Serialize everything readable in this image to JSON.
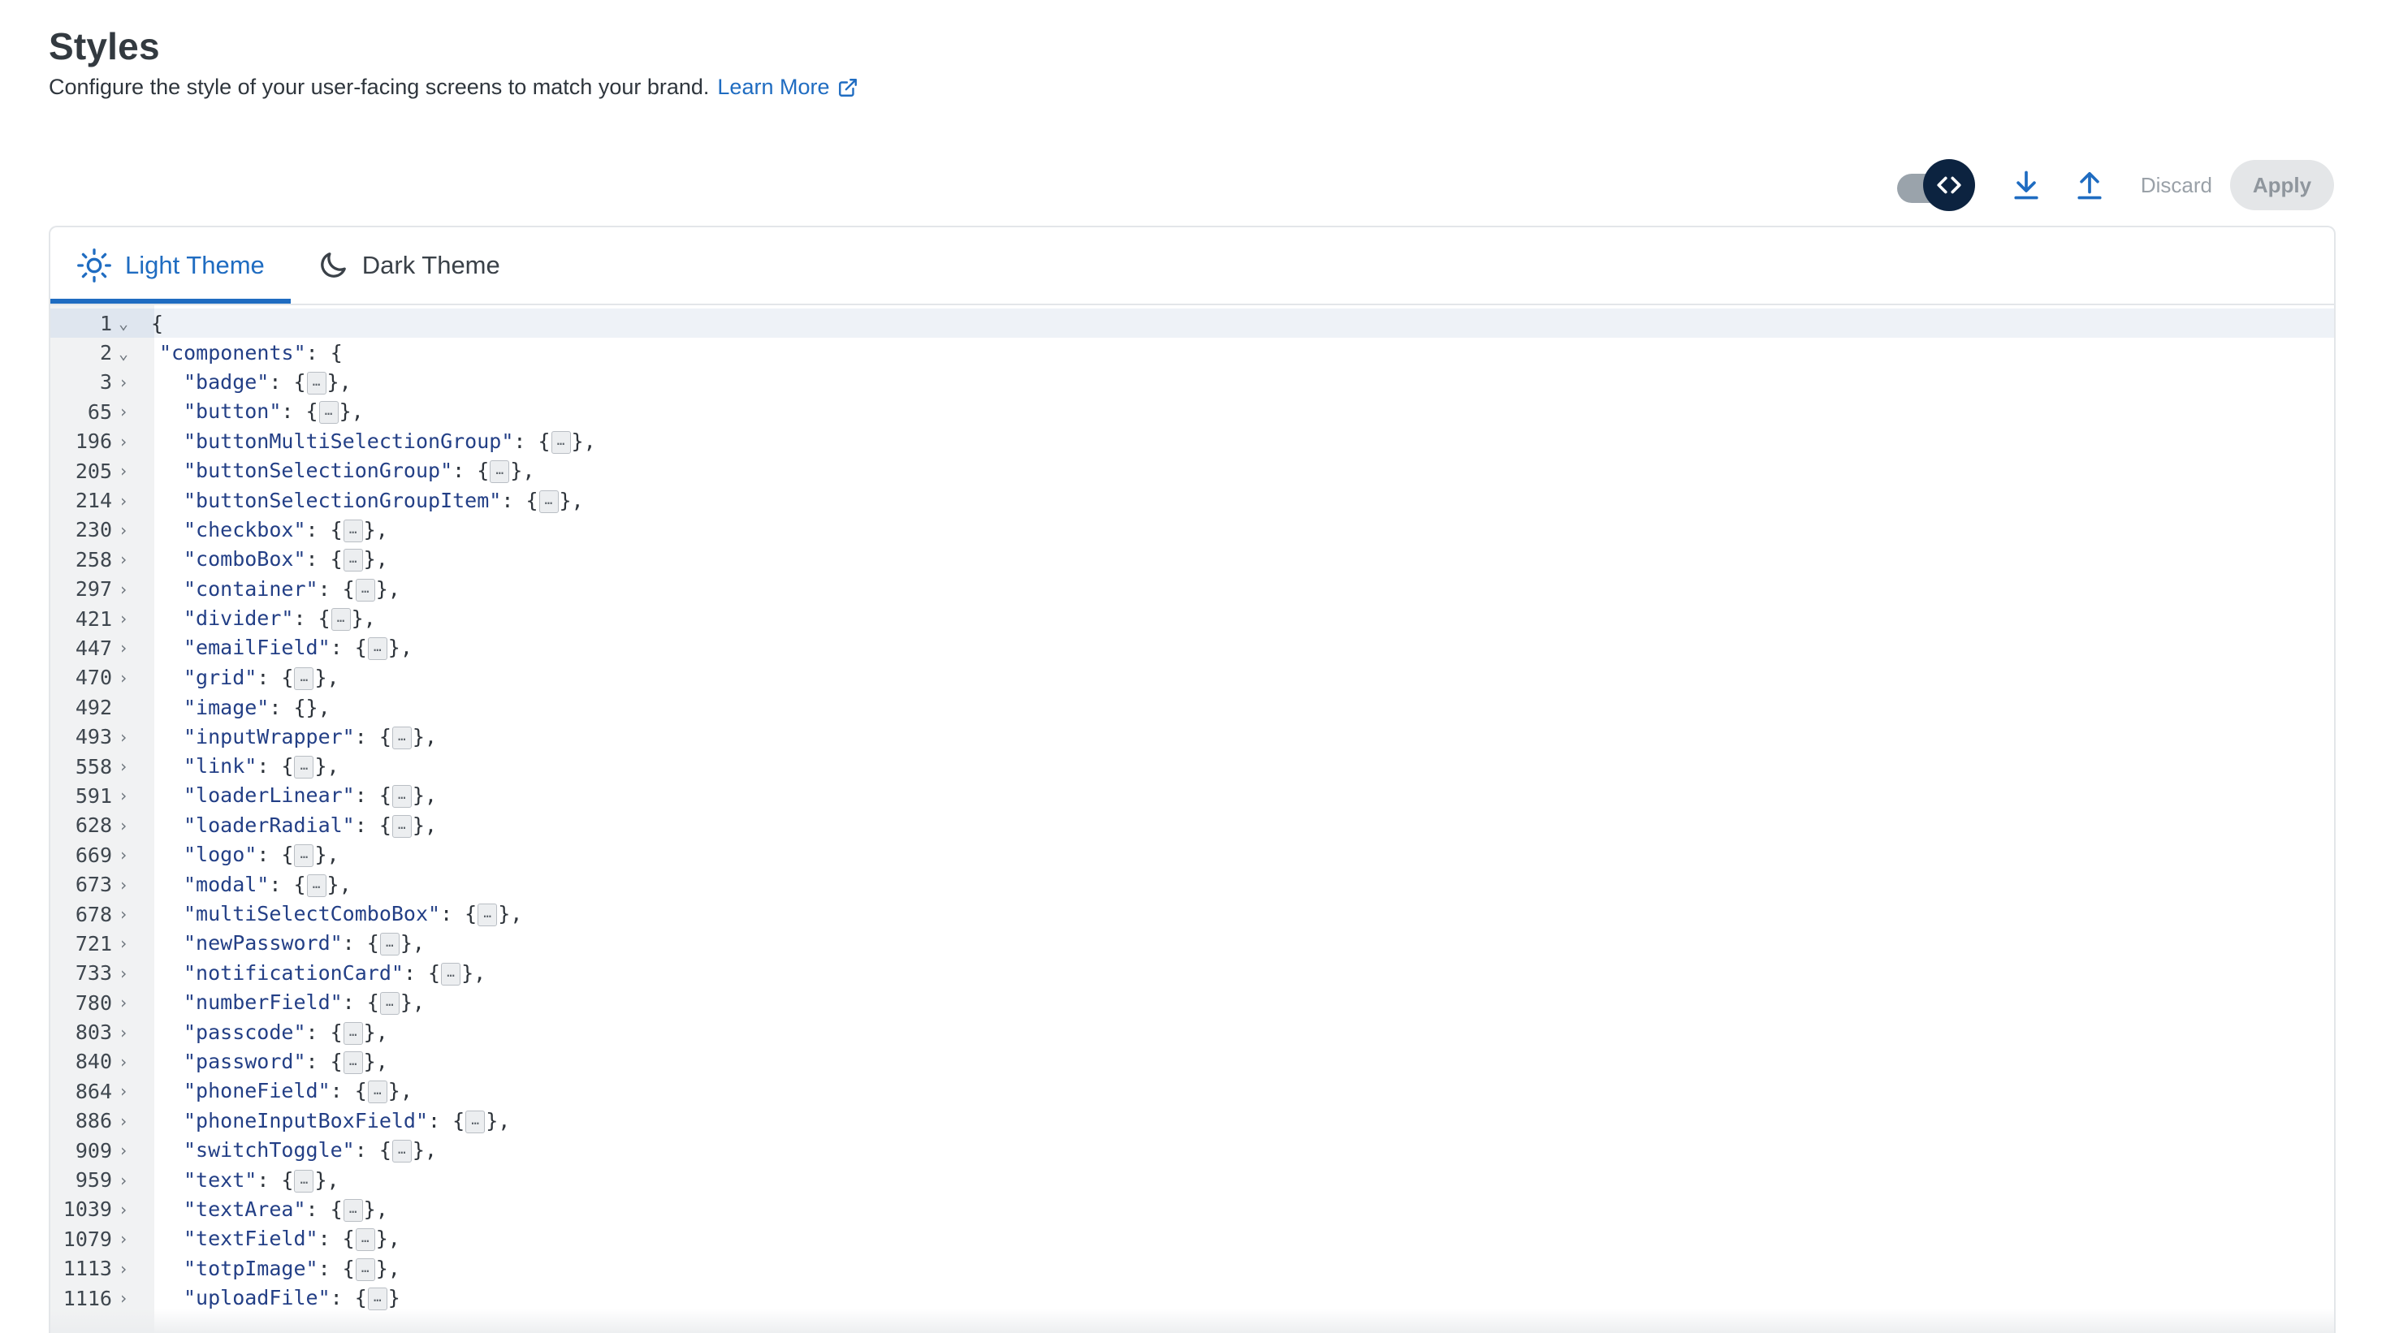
{
  "header": {
    "title": "Styles",
    "subtitle": "Configure the style of your user-facing screens to match your brand.",
    "learn_more": "Learn More"
  },
  "toolbar": {
    "toggle_icon": "code-icon",
    "download_icon": "download-icon",
    "upload_icon": "upload-icon",
    "discard_label": "Discard",
    "apply_label": "Apply"
  },
  "tabs": [
    {
      "label": "Light Theme",
      "icon": "sun-icon",
      "active": true
    },
    {
      "label": "Dark Theme",
      "icon": "moon-icon",
      "active": false
    }
  ],
  "editor": {
    "lines": [
      {
        "num": "1",
        "fold": "open",
        "indent": 0,
        "text": "{"
      },
      {
        "num": "2",
        "fold": "open",
        "indent": 1,
        "key": "components",
        "tail": ": {"
      },
      {
        "num": "3",
        "fold": "closed",
        "indent": 2,
        "key": "badge",
        "collapsed": true,
        "comma": true
      },
      {
        "num": "65",
        "fold": "closed",
        "indent": 2,
        "key": "button",
        "collapsed": true,
        "comma": true
      },
      {
        "num": "196",
        "fold": "closed",
        "indent": 2,
        "key": "buttonMultiSelectionGroup",
        "collapsed": true,
        "comma": true
      },
      {
        "num": "205",
        "fold": "closed",
        "indent": 2,
        "key": "buttonSelectionGroup",
        "collapsed": true,
        "comma": true
      },
      {
        "num": "214",
        "fold": "closed",
        "indent": 2,
        "key": "buttonSelectionGroupItem",
        "collapsed": true,
        "comma": true
      },
      {
        "num": "230",
        "fold": "closed",
        "indent": 2,
        "key": "checkbox",
        "collapsed": true,
        "comma": true
      },
      {
        "num": "258",
        "fold": "closed",
        "indent": 2,
        "key": "comboBox",
        "collapsed": true,
        "comma": true
      },
      {
        "num": "297",
        "fold": "closed",
        "indent": 2,
        "key": "container",
        "collapsed": true,
        "comma": true
      },
      {
        "num": "421",
        "fold": "closed",
        "indent": 2,
        "key": "divider",
        "collapsed": true,
        "comma": true
      },
      {
        "num": "447",
        "fold": "closed",
        "indent": 2,
        "key": "emailField",
        "collapsed": true,
        "comma": true
      },
      {
        "num": "470",
        "fold": "closed",
        "indent": 2,
        "key": "grid",
        "collapsed": true,
        "comma": true
      },
      {
        "num": "492",
        "fold": "none",
        "indent": 2,
        "key": "image",
        "tail": ": {},"
      },
      {
        "num": "493",
        "fold": "closed",
        "indent": 2,
        "key": "inputWrapper",
        "collapsed": true,
        "comma": true
      },
      {
        "num": "558",
        "fold": "closed",
        "indent": 2,
        "key": "link",
        "collapsed": true,
        "comma": true
      },
      {
        "num": "591",
        "fold": "closed",
        "indent": 2,
        "key": "loaderLinear",
        "collapsed": true,
        "comma": true
      },
      {
        "num": "628",
        "fold": "closed",
        "indent": 2,
        "key": "loaderRadial",
        "collapsed": true,
        "comma": true
      },
      {
        "num": "669",
        "fold": "closed",
        "indent": 2,
        "key": "logo",
        "collapsed": true,
        "comma": true
      },
      {
        "num": "673",
        "fold": "closed",
        "indent": 2,
        "key": "modal",
        "collapsed": true,
        "comma": true
      },
      {
        "num": "678",
        "fold": "closed",
        "indent": 2,
        "key": "multiSelectComboBox",
        "collapsed": true,
        "comma": true
      },
      {
        "num": "721",
        "fold": "closed",
        "indent": 2,
        "key": "newPassword",
        "collapsed": true,
        "comma": true
      },
      {
        "num": "733",
        "fold": "closed",
        "indent": 2,
        "key": "notificationCard",
        "collapsed": true,
        "comma": true
      },
      {
        "num": "780",
        "fold": "closed",
        "indent": 2,
        "key": "numberField",
        "collapsed": true,
        "comma": true
      },
      {
        "num": "803",
        "fold": "closed",
        "indent": 2,
        "key": "passcode",
        "collapsed": true,
        "comma": true
      },
      {
        "num": "840",
        "fold": "closed",
        "indent": 2,
        "key": "password",
        "collapsed": true,
        "comma": true
      },
      {
        "num": "864",
        "fold": "closed",
        "indent": 2,
        "key": "phoneField",
        "collapsed": true,
        "comma": true
      },
      {
        "num": "886",
        "fold": "closed",
        "indent": 2,
        "key": "phoneInputBoxField",
        "collapsed": true,
        "comma": true
      },
      {
        "num": "909",
        "fold": "closed",
        "indent": 2,
        "key": "switchToggle",
        "collapsed": true,
        "comma": true
      },
      {
        "num": "959",
        "fold": "closed",
        "indent": 2,
        "key": "text",
        "collapsed": true,
        "comma": true
      },
      {
        "num": "1039",
        "fold": "closed",
        "indent": 2,
        "key": "textArea",
        "collapsed": true,
        "comma": true
      },
      {
        "num": "1079",
        "fold": "closed",
        "indent": 2,
        "key": "textField",
        "collapsed": true,
        "comma": true
      },
      {
        "num": "1113",
        "fold": "closed",
        "indent": 2,
        "key": "totpImage",
        "collapsed": true,
        "comma": true
      },
      {
        "num": "1116",
        "fold": "closed",
        "indent": 2,
        "key": "uploadFile",
        "collapsed": true,
        "comma": false
      }
    ]
  },
  "colors": {
    "accent": "#1f6cc1",
    "toggle_knob": "#0c2340",
    "json_key": "#233f86"
  }
}
